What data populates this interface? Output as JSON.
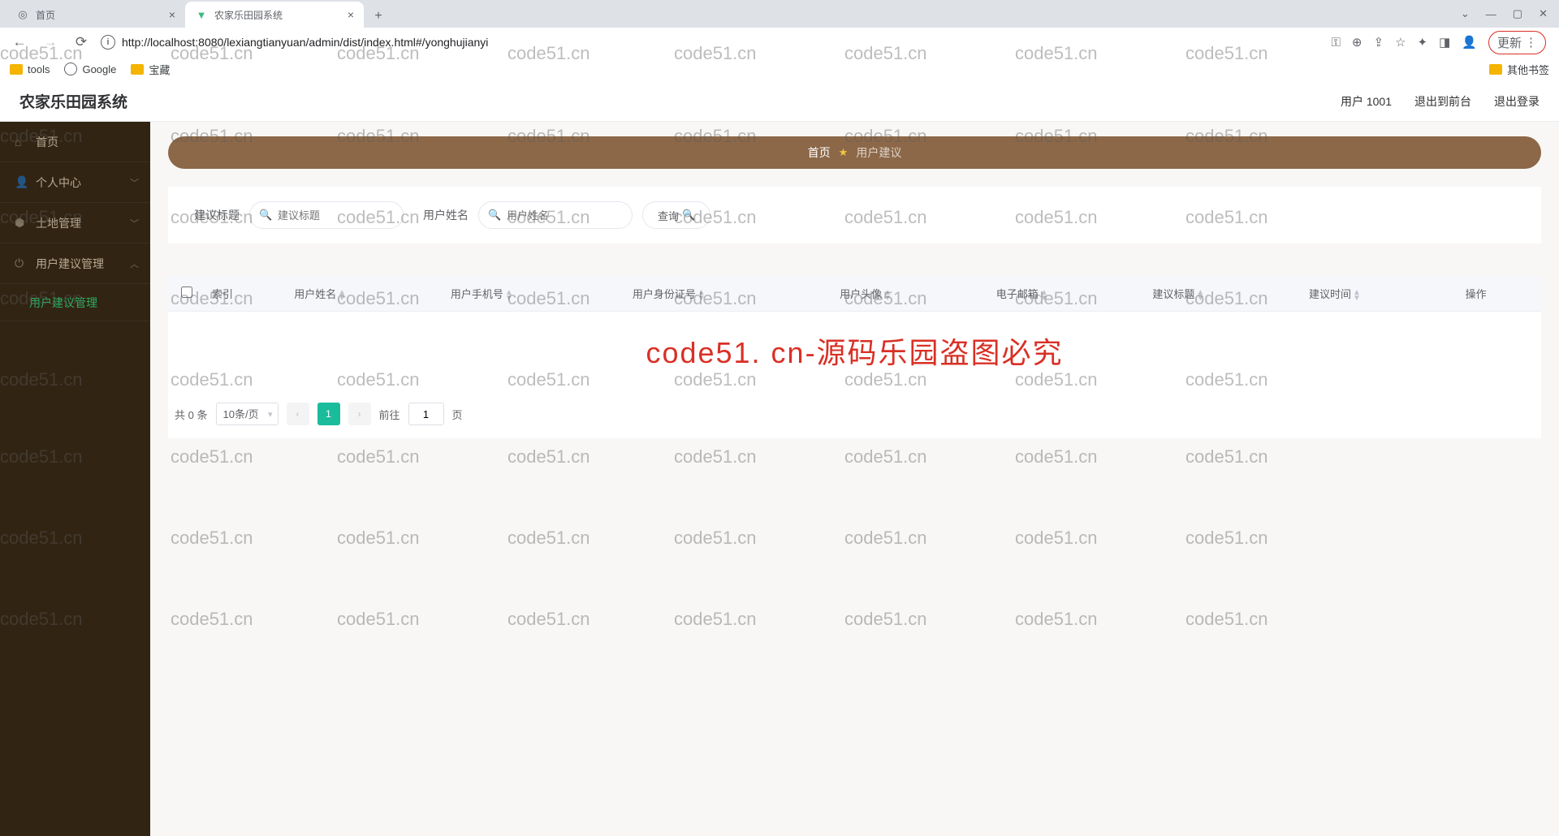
{
  "browser": {
    "tabs": [
      {
        "title": "首页",
        "active": false
      },
      {
        "title": "农家乐田园系统",
        "active": true
      }
    ],
    "url": "http://localhost:8080/lexiangtianyuan/admin/dist/index.html#/yonghujianyi",
    "update_label": "更新",
    "bookmarks": {
      "tools": "tools",
      "google": "Google",
      "baozang": "宝藏",
      "other": "其他书签"
    }
  },
  "app": {
    "title": "农家乐田园系统",
    "header": {
      "user": "用户 1001",
      "to_front": "退出到前台",
      "logout": "退出登录"
    },
    "sidebar": {
      "home": "首页",
      "personal": "个人中心",
      "land": "土地管理",
      "suggestion_mgmt": "用户建议管理",
      "suggestion_sub": "用户建议管理"
    },
    "breadcrumb": {
      "home": "首页",
      "current": "用户建议"
    },
    "filters": {
      "title_label": "建议标题",
      "title_placeholder": "建议标题",
      "name_label": "用户姓名",
      "name_placeholder": "用户姓名",
      "query": "查询"
    },
    "table": {
      "columns": [
        "索引",
        "用户姓名",
        "用户手机号",
        "用户身份证号",
        "用户头像",
        "电子邮箱",
        "建议标题",
        "建议时间",
        "操作"
      ]
    },
    "watermark_center": "code51. cn-源码乐园盗图必究",
    "pagination": {
      "total_prefix": "共",
      "total_count": "0",
      "total_suffix": "条",
      "page_size": "10条/页",
      "current": "1",
      "goto_prefix": "前往",
      "goto_value": "1",
      "goto_suffix": "页"
    }
  },
  "watermark_text": "code51.cn"
}
